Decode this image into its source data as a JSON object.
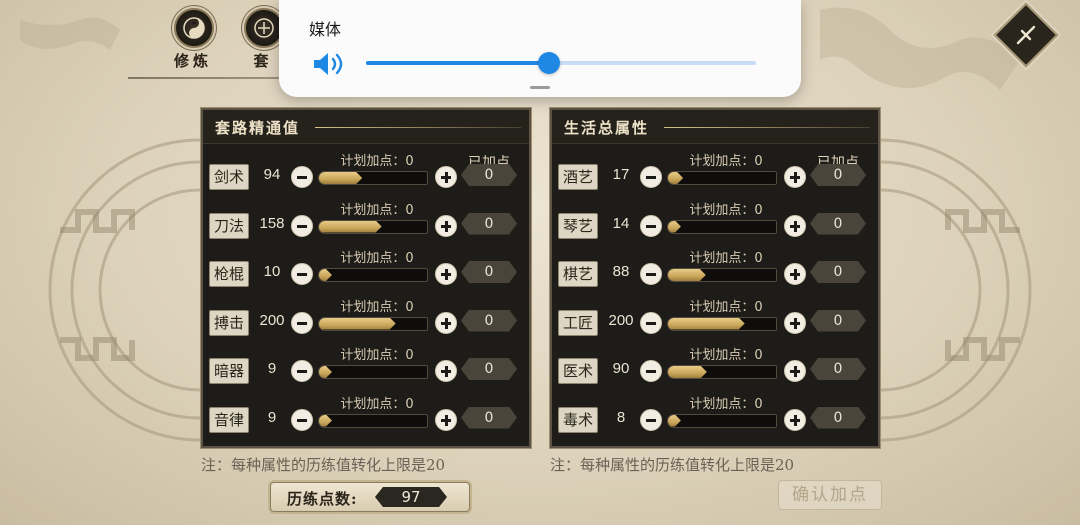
{
  "nav": {
    "items": [
      {
        "label": "修炼",
        "icon": "taiji-icon"
      },
      {
        "label": "套",
        "icon": "emblem-icon"
      }
    ]
  },
  "panels": {
    "left": {
      "title": "套路精通值",
      "added_header": "已加点",
      "note": "注：每种属性的历练值转化上限是20",
      "rows": [
        {
          "name": "剑术",
          "value": "94",
          "plan_label": "计划加点：0",
          "added": "0",
          "fill": 0.4
        },
        {
          "name": "刀法",
          "value": "158",
          "plan_label": "计划加点：0",
          "added": "0",
          "fill": 0.58
        },
        {
          "name": "枪棍",
          "value": "10",
          "plan_label": "计划加点：0",
          "added": "0",
          "fill": 0.12
        },
        {
          "name": "搏击",
          "value": "200",
          "plan_label": "计划加点：0",
          "added": "0",
          "fill": 0.71
        },
        {
          "name": "暗器",
          "value": "9",
          "plan_label": "计划加点：0",
          "added": "0",
          "fill": 0.12
        },
        {
          "name": "音律",
          "value": "9",
          "plan_label": "计划加点：0",
          "added": "0",
          "fill": 0.12
        }
      ]
    },
    "right": {
      "title": "生活总属性",
      "added_header": "已加点",
      "note": "注：每种属性的历练值转化上限是20",
      "rows": [
        {
          "name": "酒艺",
          "value": "17",
          "plan_label": "计划加点：0",
          "added": "0",
          "fill": 0.14
        },
        {
          "name": "琴艺",
          "value": "14",
          "plan_label": "计划加点：0",
          "added": "0",
          "fill": 0.12
        },
        {
          "name": "棋艺",
          "value": "88",
          "plan_label": "计划加点：0",
          "added": "0",
          "fill": 0.35
        },
        {
          "name": "工匠",
          "value": "200",
          "plan_label": "计划加点：0",
          "added": "0",
          "fill": 0.71
        },
        {
          "name": "医术",
          "value": "90",
          "plan_label": "计划加点：0",
          "added": "0",
          "fill": 0.36
        },
        {
          "name": "毒术",
          "value": "8",
          "plan_label": "计划加点：0",
          "added": "0",
          "fill": 0.12
        }
      ]
    }
  },
  "footer": {
    "exp_label": "历练点数:",
    "exp_value": "97",
    "confirm_label": "确认加点"
  },
  "media": {
    "title": "媒体",
    "volume": 0.47
  },
  "colors": {
    "panel_bg": "#1e1c18",
    "gold_fill": "#c9a65a",
    "media_accent": "#1f88e5"
  }
}
